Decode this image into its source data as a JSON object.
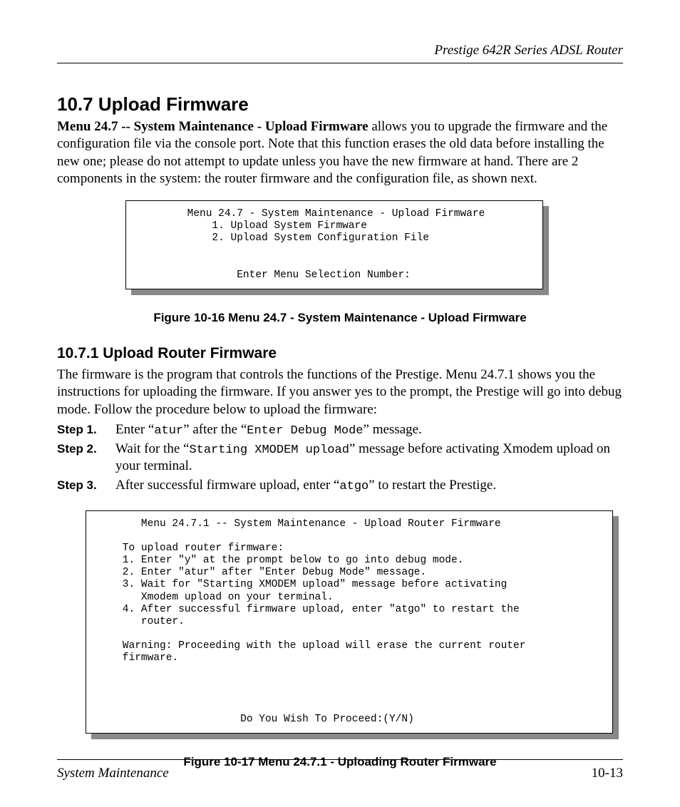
{
  "header": {
    "right": "Prestige 642R Series ADSL Router"
  },
  "section": {
    "h1": "10.7  Upload Firmware",
    "intro_bold": "Menu 24.7 -- System Maintenance - Upload Firmware",
    "intro_rest": " allows you to upgrade the firmware and the configuration file via the console port. Note that this function erases the old data before installing the new one; please do not attempt to update unless you have the new firmware at hand. There are 2 components in the system: the router firmware and the configuration file, as shown next."
  },
  "figure1": {
    "terminal": "        Menu 24.7 - System Maintenance - Upload Firmware\n            1. Upload System Firmware\n            2. Upload System Configuration File\n\n\n                Enter Menu Selection Number:",
    "caption": "Figure 10-16    Menu 24.7 - System Maintenance - Upload Firmware"
  },
  "subsection": {
    "h2": "10.7.1 Upload Router Firmware",
    "para": "The firmware is the program that controls the functions of the Prestige.  Menu 24.7.1 shows you the instructions for uploading the firmware. If you answer yes to the prompt, the Prestige will go into debug mode.  Follow the procedure below to upload the firmware:",
    "steps": [
      {
        "label": "Step 1.",
        "pre": "Enter “",
        "mono1": "atur",
        "mid": "” after the “",
        "mono2": "Enter Debug Mode",
        "post": "” message."
      },
      {
        "label": "Step 2.",
        "pre": "Wait for the “",
        "mono1": "Starting XMODEM upload",
        "mid": "” message before activating Xmodem upload on your terminal.",
        "mono2": "",
        "post": ""
      },
      {
        "label": "Step 3.",
        "pre": "After successful firmware upload, enter “",
        "mono1": "atgo",
        "mid": "” to restart the Prestige.",
        "mono2": "",
        "post": ""
      }
    ]
  },
  "figure2": {
    "terminal": "       Menu 24.7.1 -- System Maintenance - Upload Router Firmware\n\n    To upload router firmware:\n    1. Enter \"y\" at the prompt below to go into debug mode.\n    2. Enter \"atur\" after \"Enter Debug Mode\" message.\n    3. Wait for \"Starting XMODEM upload\" message before activating\n       Xmodem upload on your terminal.\n    4. After successful firmware upload, enter \"atgo\" to restart the\n       router.\n\n    Warning: Proceeding with the upload will erase the current router\n    firmware.\n\n\n\n\n                       Do You Wish To Proceed:(Y/N)",
    "caption": "Figure 10-17    Menu 24.7.1 - Uploading Router Firmware"
  },
  "footer": {
    "left": "System Maintenance",
    "right": "10-13"
  }
}
